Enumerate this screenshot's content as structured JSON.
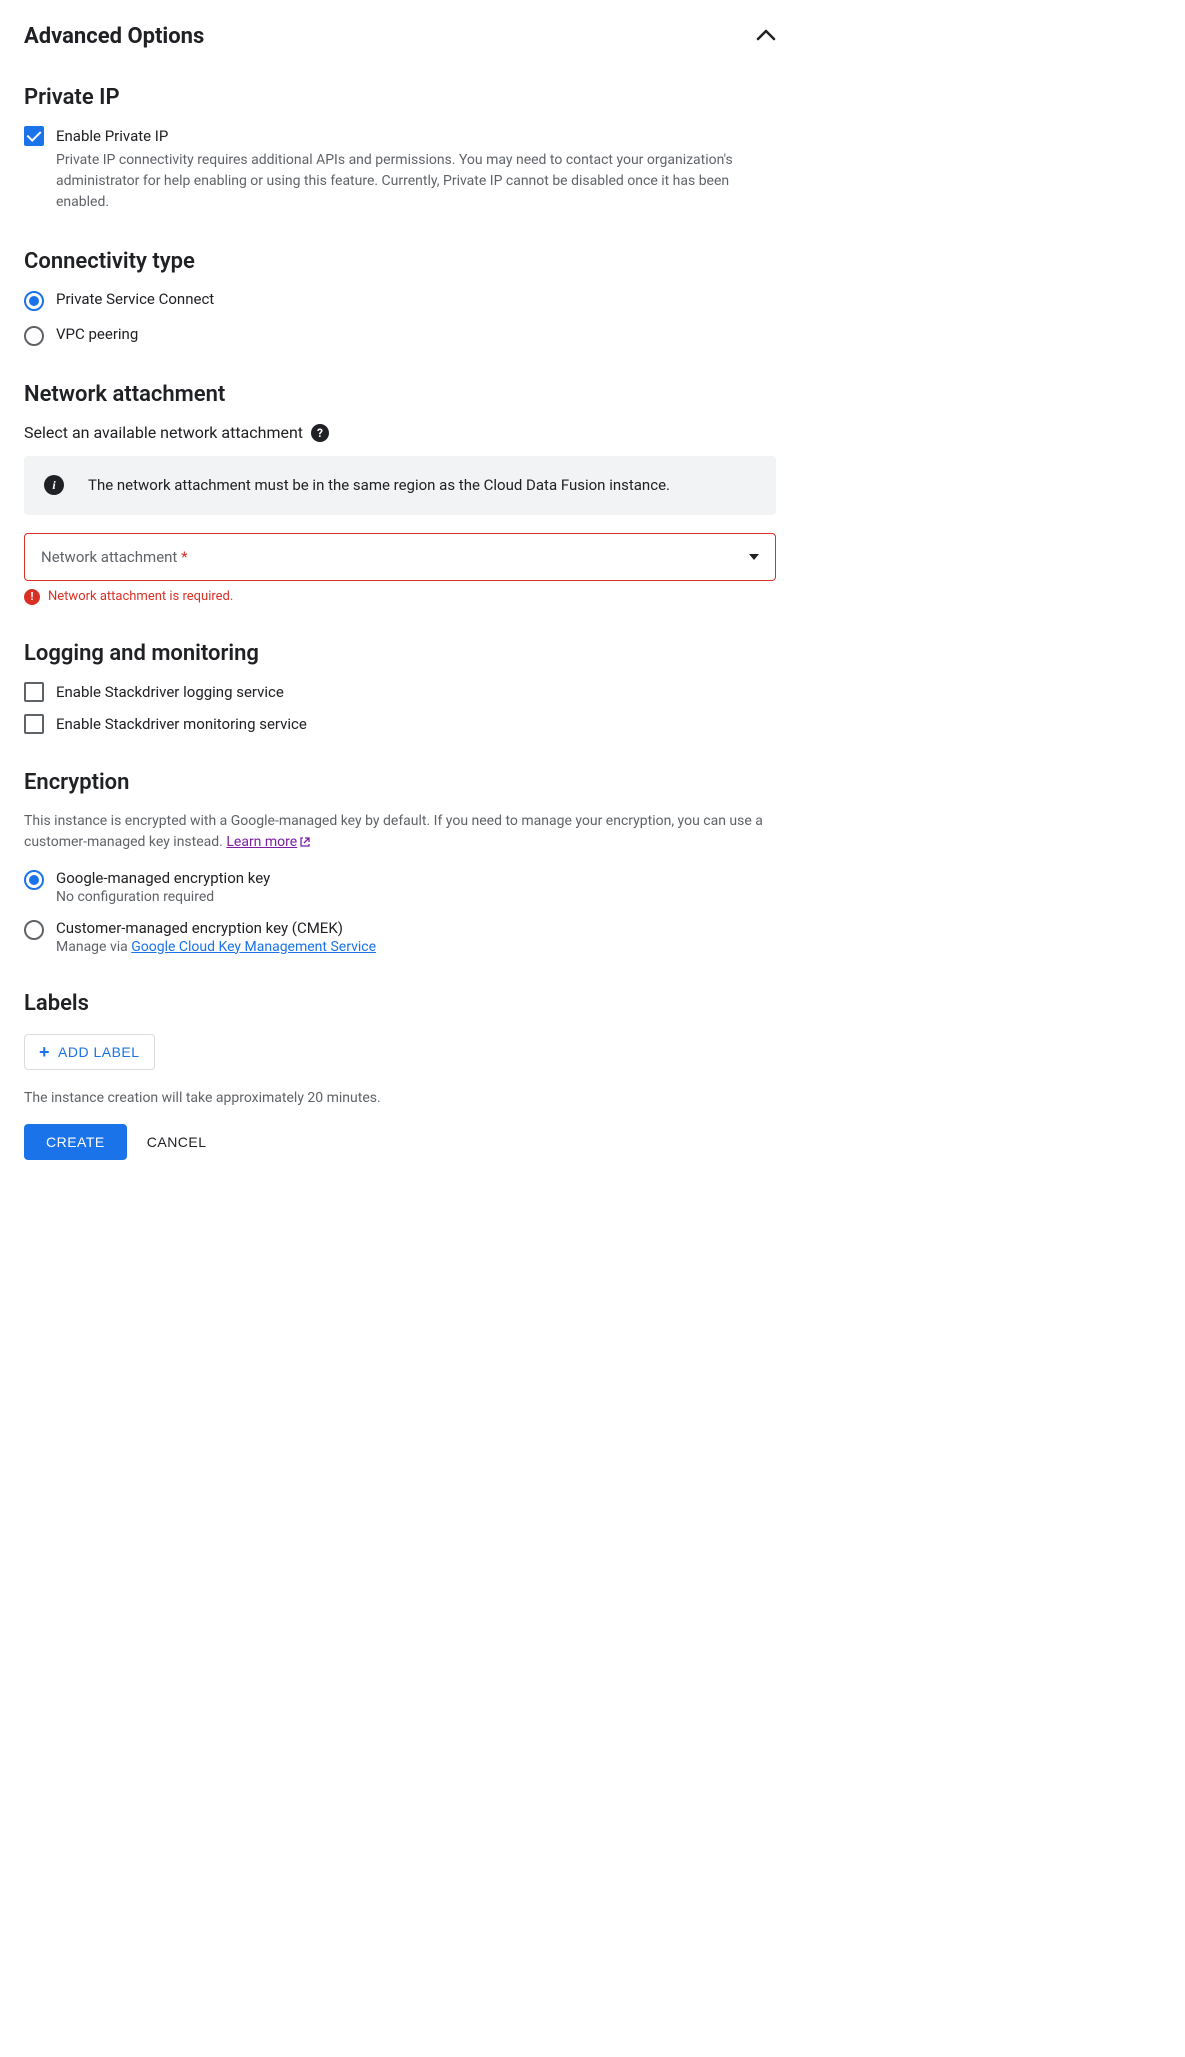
{
  "header": {
    "title": "Advanced Options"
  },
  "privateIp": {
    "heading": "Private IP",
    "checkboxLabel": "Enable Private IP",
    "helper": "Private IP connectivity requires additional APIs and permissions. You may need to contact your organization's administrator for help enabling or using this feature. Currently, Private IP cannot be disabled once it has been enabled."
  },
  "connectivity": {
    "heading": "Connectivity type",
    "options": [
      "Private Service Connect",
      "VPC peering"
    ]
  },
  "networkAttachment": {
    "heading": "Network attachment",
    "subheading": "Select an available network attachment",
    "info": "The network attachment must be in the same region as the Cloud Data Fusion instance.",
    "placeholder": "Network attachment",
    "error": "Network attachment is required."
  },
  "logging": {
    "heading": "Logging and monitoring",
    "options": [
      "Enable Stackdriver logging service",
      "Enable Stackdriver monitoring service"
    ]
  },
  "encryption": {
    "heading": "Encryption",
    "desc": "This instance is encrypted with a Google-managed key by default. If you need to manage your encryption, you can use a customer-managed key instead.",
    "learnMore": "Learn more",
    "googleManaged": {
      "label": "Google-managed encryption key",
      "sub": "No configuration required"
    },
    "cmek": {
      "label": "Customer-managed encryption key (CMEK)",
      "subPrefix": "Manage via ",
      "subLink": "Google Cloud Key Management Service"
    }
  },
  "labels": {
    "heading": "Labels",
    "addButton": "ADD LABEL"
  },
  "footer": {
    "note": "The instance creation will take approximately 20 minutes.",
    "create": "CREATE",
    "cancel": "CANCEL"
  }
}
